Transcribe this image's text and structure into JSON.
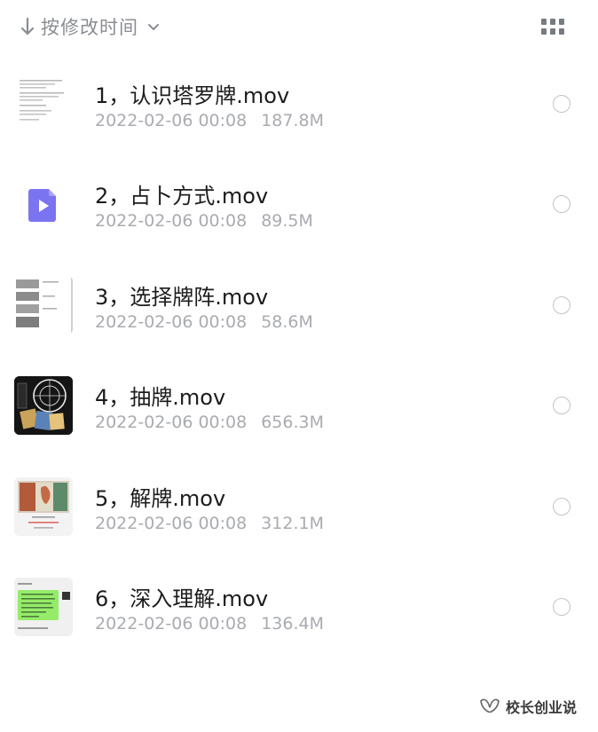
{
  "sort": {
    "label": "按修改时间",
    "arrow_icon": "arrow-down-icon",
    "chevron_icon": "chevron-down-icon"
  },
  "view_toggle": {
    "icon": "grid-view-icon"
  },
  "files": [
    {
      "name": "1，认识塔罗牌.mov",
      "date": "2022-02-06 00:08",
      "size": "187.8M",
      "thumb": "document-thumbnail"
    },
    {
      "name": "2，占卜方式.mov",
      "date": "2022-02-06 00:08",
      "size": "89.5M",
      "thumb": "video-file-icon"
    },
    {
      "name": "3，选择牌阵.mov",
      "date": "2022-02-06 00:08",
      "size": "58.6M",
      "thumb": "card-layout-thumbnail"
    },
    {
      "name": "4，抽牌.mov",
      "date": "2022-02-06 00:08",
      "size": "656.3M",
      "thumb": "tarot-cards-thumbnail"
    },
    {
      "name": "5，解牌.mov",
      "date": "2022-02-06 00:08",
      "size": "312.1M",
      "thumb": "tarot-card-thumbnail"
    },
    {
      "name": "6，深入理解.mov",
      "date": "2022-02-06 00:08",
      "size": "136.4M",
      "thumb": "chat-screenshot-thumbnail"
    }
  ],
  "watermark": {
    "text": "校长创业说",
    "icon": "wechat-channel-icon"
  },
  "colors": {
    "meta_gray": "#a9abb0",
    "accent_purple": "#7b74f0",
    "radio_border": "#c2c4c9"
  }
}
